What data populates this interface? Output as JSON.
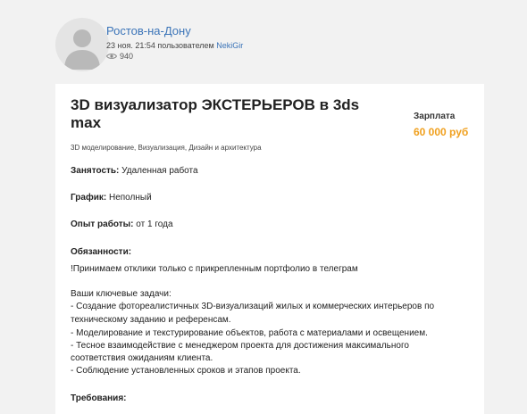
{
  "header": {
    "city": "Ростов-на-Дону",
    "date": "23 ноя. 21:54",
    "by_text": "пользователем",
    "username": "NekiGir",
    "views": "940"
  },
  "vacancy": {
    "title": "3D визуализатор ЭКСТЕРЬЕРОВ в 3ds max",
    "salary_label": "Зарплата",
    "salary_value": "60 000 руб",
    "categories": "3D моделирование, Визуализация, Дизайн и архитектура",
    "employment_label": "Занятость:",
    "employment_value": "Удаленная работа",
    "schedule_label": "График:",
    "schedule_value": "Неполный",
    "experience_label": "Опыт работы:",
    "experience_value": "от 1 года",
    "duties_heading": "Обязанности:",
    "duties_lines": [
      "!Принимаем отклики только с прикрепленным портфолио в телеграм",
      "Ваши ключевые задачи:",
      "- Создание фотореалистичных 3D-визуализаций жилых и коммерческих интерьеров по",
      "техническому заданию и референсам.",
      "- Моделирование и текстурирование объектов, работа с материалами и освещением.",
      "- Тесное взаимодействие с менеджером проекта для достижения максимального",
      "соответствия ожиданиям клиента.",
      "- Соблюдение установленных сроков и этапов проекта."
    ],
    "requirements_heading": "Требования:"
  },
  "icons": {
    "avatar": "user-silhouette-icon",
    "views": "eye-icon"
  }
}
